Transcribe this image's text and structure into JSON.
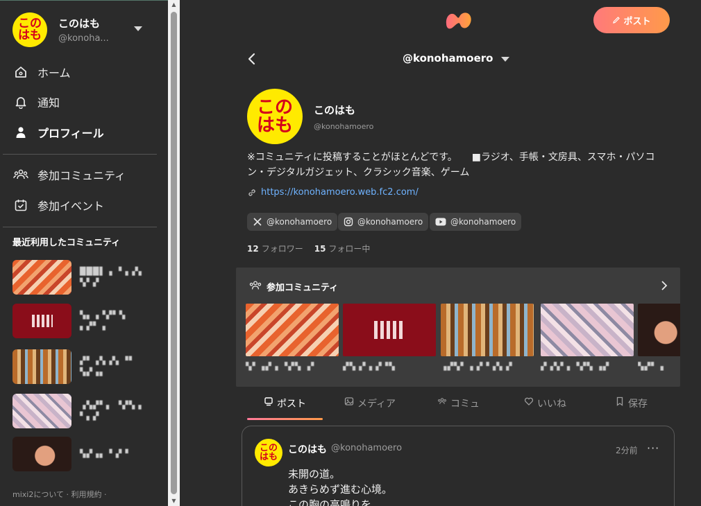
{
  "sidebar": {
    "profile": {
      "avatar_text_1": "この",
      "avatar_text_2": "はも",
      "name": "このはも",
      "handle": "@konoha..."
    },
    "nav": [
      {
        "label": "ホーム",
        "icon": "home-icon"
      },
      {
        "label": "通知",
        "icon": "bell-icon"
      },
      {
        "label": "プロフィール",
        "icon": "person-icon"
      },
      {
        "label": "参加コミュニティ",
        "icon": "people-icon"
      },
      {
        "label": "参加イベント",
        "icon": "calendar-icon"
      }
    ],
    "recent_title": "最近利用したコミュニティ",
    "recent": [
      {
        "label": "███▌ ▖▝▗ ▞▖ ▚▘▞"
      },
      {
        "label": "▚▖▗▝▞▘▚ ▖▞▘▗"
      },
      {
        "label": "▞▘▗▚ ▞▖▝▘ ▚▞▗▖"
      },
      {
        "label": "▗▚▞▘▖ ▝▞▚▗ ▘▖▞"
      },
      {
        "label": "▚▞▗▖ ▘▞▝"
      }
    ],
    "footer": {
      "about": "mixi2について",
      "sep": "·",
      "terms": "利用規約",
      "dot": "·"
    }
  },
  "header": {
    "post_button": "ポスト",
    "handle": "@konohamoero"
  },
  "profile": {
    "avatar_text_1": "この",
    "avatar_text_2": "はも",
    "name": "このはも",
    "handle": "@konohamoero",
    "bio_line1": "※コミュニティに投稿することがほとんどです。　　■ラジオ、手帳・文房具、スマホ・パソコ",
    "bio_line2": "ン・デジタルガジェット、クラシック音楽、ゲーム",
    "link": "https://konohamoero.web.fc2.com/",
    "socials": [
      {
        "service": "x-icon",
        "label": "@konohamoero"
      },
      {
        "service": "instagram-icon",
        "label": "@konohamoero"
      },
      {
        "service": "youtube-icon",
        "label": "@konohamoero"
      }
    ],
    "followers_count": "12",
    "followers_label": "フォロワー",
    "following_count": "15",
    "following_label": "フォロー中"
  },
  "communities": {
    "title": "参加コミュニティ",
    "items": [
      {
        "label": "▚▘▗▞ ▖▝▞▚ ▗▘"
      },
      {
        "label": "▞▚▗▘▖▞▝▚"
      },
      {
        "label": "▗▞▚▘ ▖▞▝▗▚ ▞"
      },
      {
        "label": "▞▗▚▘▖▝▞▚ ▗▞"
      },
      {
        "label": "▚▞▘▗"
      }
    ]
  },
  "tabs": [
    {
      "label": "ポスト",
      "icon": "post-icon"
    },
    {
      "label": "メディア",
      "icon": "media-icon"
    },
    {
      "label": "コミュ",
      "icon": "community-icon"
    },
    {
      "label": "いいね",
      "icon": "heart-icon"
    },
    {
      "label": "保存",
      "icon": "bookmark-icon"
    }
  ],
  "post": {
    "avatar_text_1": "この",
    "avatar_text_2": "はも",
    "name": "このはも",
    "handle": "@konohamoero",
    "time": "2分前",
    "more": "···",
    "lines": [
      "未開の道。",
      "あきらめず進む心境。",
      "この胸の高鳴りを"
    ]
  },
  "colors": {
    "background": "#2b2b2b",
    "panel": "#3c3c3c",
    "accent_gradient_start": "#ff7a7a",
    "accent_gradient_end": "#ff9a4a",
    "link": "#6fb3ff",
    "avatar_yellow": "#ffea00",
    "avatar_red": "#d4001b"
  }
}
